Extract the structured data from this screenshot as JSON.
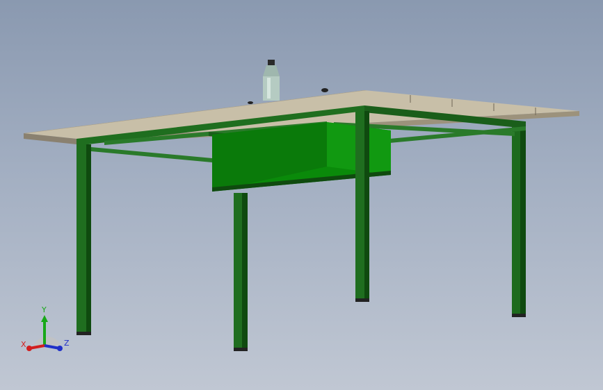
{
  "view": {
    "background_top": "#8a99b0",
    "background_bottom": "#c0c7d3"
  },
  "model": {
    "frame_color": "#1f6e1f",
    "box_color": "#0a8a0a",
    "top_color": "#b9ad93",
    "bottle_color": "#9fb7ae"
  },
  "triad": {
    "x_label": "X",
    "y_label": "Y",
    "z_label": "Z",
    "x_color": "#d21e1e",
    "y_color": "#18a818",
    "z_color": "#2030c8"
  }
}
